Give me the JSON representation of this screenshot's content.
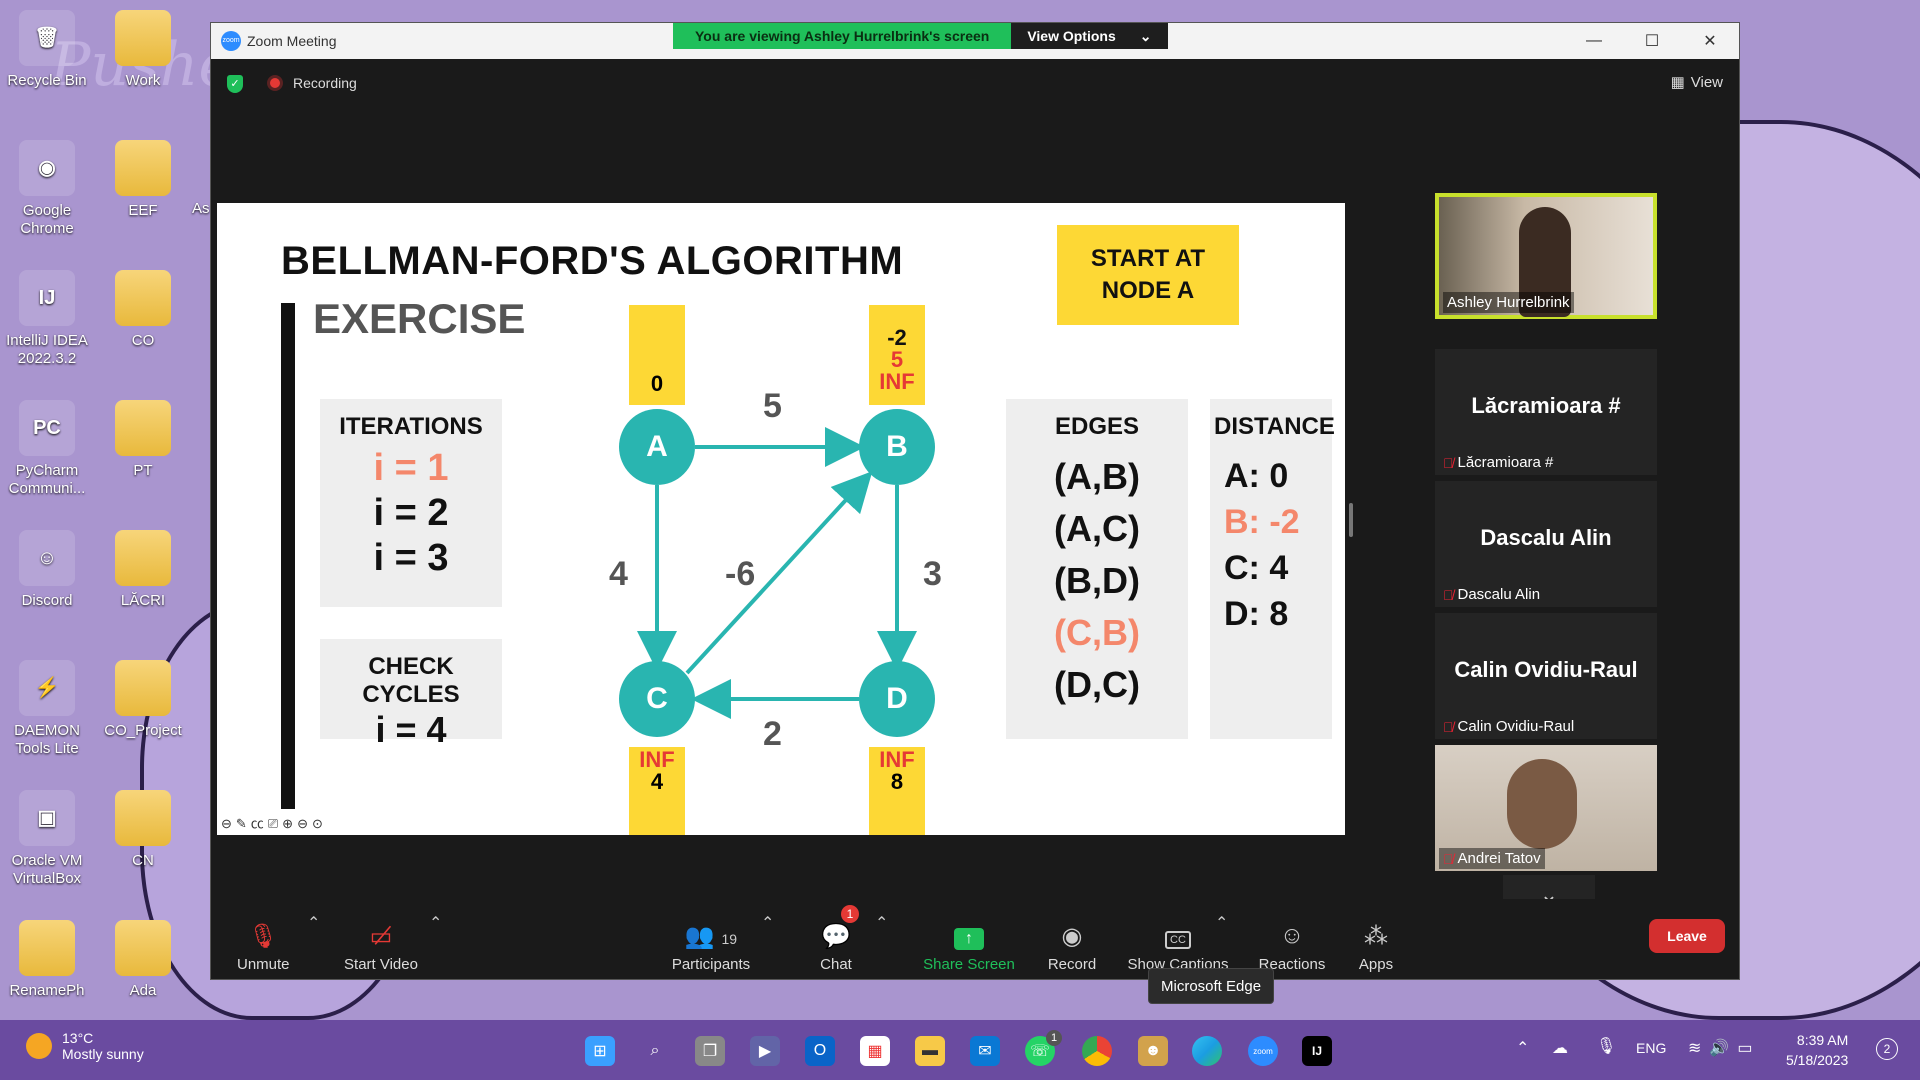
{
  "desktop": {
    "icons": [
      {
        "label": "Recycle Bin",
        "glyph": "🗑"
      },
      {
        "label": "Work",
        "glyph": ""
      },
      {
        "label": "Google Chrome",
        "glyph": "◉"
      },
      {
        "label": "EEF",
        "glyph": ""
      },
      {
        "label": "IntelliJ IDEA 2022.3.2",
        "glyph": "IJ"
      },
      {
        "label": "CO",
        "glyph": ""
      },
      {
        "label": "PyCharm Communi...",
        "glyph": "PC"
      },
      {
        "label": "PT",
        "glyph": ""
      },
      {
        "label": "Discord",
        "glyph": "☺"
      },
      {
        "label": "LĂCRI",
        "glyph": ""
      },
      {
        "label": "DAEMON Tools Lite",
        "glyph": "⚡"
      },
      {
        "label": "CO_Project",
        "glyph": ""
      },
      {
        "label": "Oracle VM VirtualBox",
        "glyph": "▣"
      },
      {
        "label": "CN",
        "glyph": ""
      },
      {
        "label": "RenamePh",
        "glyph": ""
      },
      {
        "label": "Ada",
        "glyph": ""
      }
    ],
    "partial_label": "As",
    "watermark": "Pusheen"
  },
  "zoom": {
    "window_title": "Zoom Meeting",
    "banner_text": "You are viewing Ashley Hurrelbrink's screen",
    "view_options": "View Options",
    "recording": "Recording",
    "view_label": "View",
    "slide": {
      "title": "BELLMAN-FORD'S ALGORITHM",
      "subtitle": "EXERCISE",
      "start_box": [
        "START AT",
        "NODE A"
      ],
      "iterations_title": "ITERATIONS",
      "iterations": [
        "i = 1",
        "i = 2",
        "i = 3"
      ],
      "check_cycles_title": "CHECK CYCLES",
      "check_cycles_value": "i = 4",
      "nodes": [
        "A",
        "B",
        "C",
        "D"
      ],
      "edge_weights": {
        "AB": "5",
        "AC": "4",
        "CB": "-6",
        "BD": "3",
        "DC": "2"
      },
      "labels": {
        "A": [
          "0"
        ],
        "B": [
          "-2",
          "5",
          "INF"
        ],
        "C": [
          "INF",
          "4"
        ],
        "D": [
          "INF",
          "8"
        ]
      },
      "edges_title": "EDGES",
      "edges": [
        "(A,B)",
        "(A,C)",
        "(B,D)",
        "(C,B)",
        "(D,C)"
      ],
      "distance_title": "DISTANCE",
      "distances": [
        "A: 0",
        "B: -2",
        "C: 4",
        "D: 8"
      ]
    },
    "participants_tiles": [
      {
        "name": "Ashley Hurrelbrink",
        "video": true,
        "muted": false
      },
      {
        "name": "Lăcramioara #",
        "big": "Lăcramioara #",
        "muted": true
      },
      {
        "name": "Dascalu Alin",
        "big": "Dascalu Alin",
        "muted": true
      },
      {
        "name": "Calin Ovidiu-Raul",
        "big": "Calin Ovidiu-Raul",
        "muted": true
      },
      {
        "name": "Andrei Tatov",
        "video": true,
        "muted": true
      }
    ],
    "toolbar": {
      "unmute": "Unmute",
      "start_video": "Start Video",
      "participants": "Participants",
      "participants_count": "19",
      "chat": "Chat",
      "chat_badge": "1",
      "share_screen": "Share Screen",
      "record": "Record",
      "captions": "Show Captions",
      "reactions": "Reactions",
      "apps": "Apps",
      "leave": "Leave"
    },
    "tooltip": "Microsoft Edge"
  },
  "taskbar": {
    "weather_temp": "13°C",
    "weather_desc": "Mostly sunny",
    "lang": "ENG",
    "time": "8:39 AM",
    "date": "5/18/2023",
    "notif": "2",
    "whatsapp_badge": "1"
  },
  "colors": {
    "teal": "#29b5b0",
    "yellow": "#fdd835",
    "salmon": "#f4876b",
    "red": "#e53935",
    "green": "#1fbf5a"
  }
}
